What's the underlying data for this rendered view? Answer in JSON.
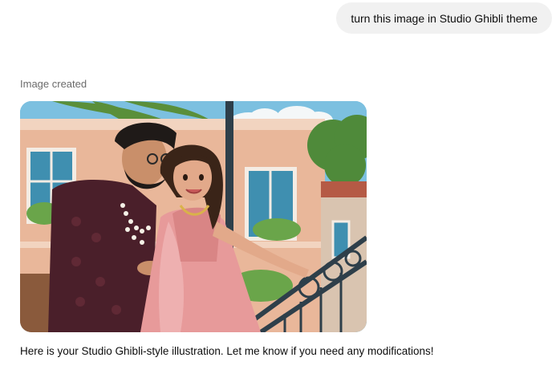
{
  "user_message": {
    "text": "turn this image in Studio Ghibli theme"
  },
  "assistant": {
    "status_label": "Image created",
    "image": {
      "icon": "generated-illustration",
      "colors": {
        "sky": "#7cc0e0",
        "building": "#e9b79a",
        "window": "#3f8fb0",
        "palm": "#5a8f3a",
        "kurta": "#4a1f2a",
        "lehenga": "#e79a9a",
        "railing": "#2e3f4a"
      }
    },
    "reply_text": "Here is your Studio Ghibli-style illustration. Let me know if you need any modifications!"
  }
}
